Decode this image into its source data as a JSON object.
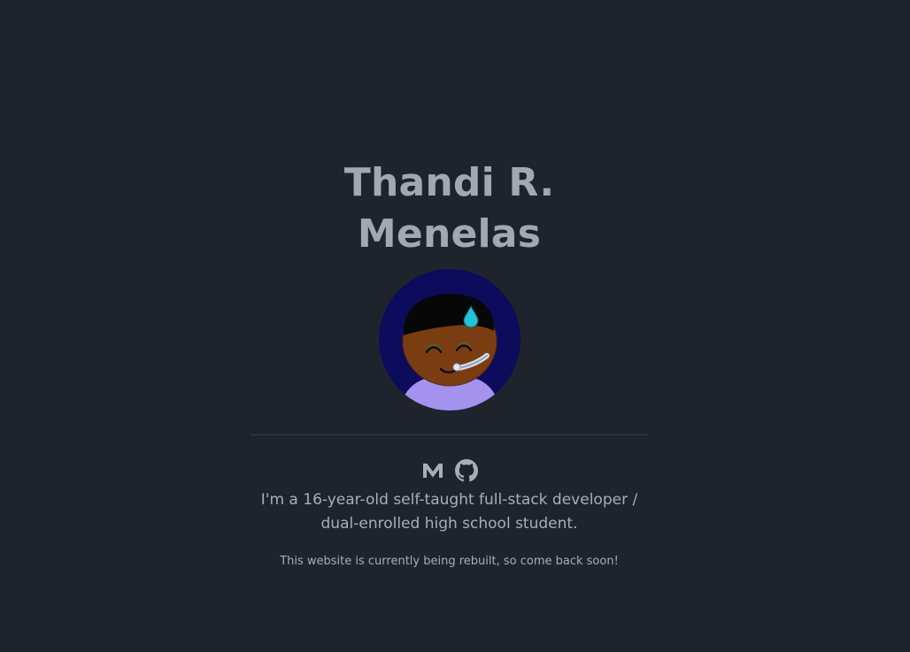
{
  "profile": {
    "name": "Thandi R. Menelas",
    "avatar_alt": "cartoon avatar",
    "bio": "I'm a 16-year-old self-taught full-stack developer / dual-enrolled high school student.",
    "notice": "This website is currently being rebuilt, so come back soon!"
  },
  "social_links": [
    {
      "label": "Medium",
      "icon": "medium-icon"
    },
    {
      "label": "GitHub",
      "icon": "github-icon"
    }
  ],
  "colors": {
    "background": "#1f242c",
    "title": "#a1a8b4",
    "text": "#a9aeb6",
    "avatar_bg": "#0d0b5c"
  }
}
